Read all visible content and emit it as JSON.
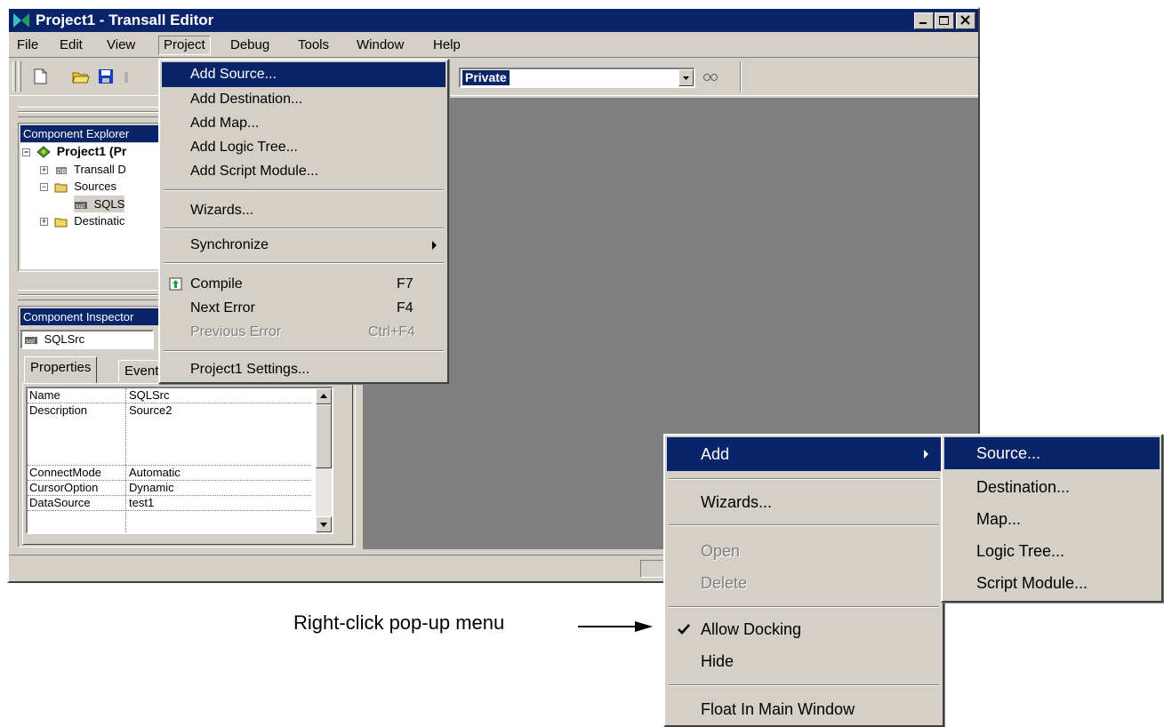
{
  "window": {
    "title": "Project1 - Transall Editor"
  },
  "menubar": [
    "File",
    "Edit",
    "View",
    "Project",
    "Debug",
    "Tools",
    "Window",
    "Help"
  ],
  "toolbar": {
    "combo_value": "Private"
  },
  "component_explorer": {
    "caption": "Component Explorer",
    "items": [
      "Project1 (Pr",
      "Transall D",
      "Sources",
      "SQLS",
      "Destinatic"
    ]
  },
  "component_inspector": {
    "caption": "Component Inspector",
    "selected_component": "SQLSrc",
    "tabs": [
      "Properties",
      "Events"
    ],
    "properties": [
      {
        "name": "Name",
        "value": "SQLSrc"
      },
      {
        "name": "Description",
        "value": "Source2"
      },
      {
        "name": "ConnectMode",
        "value": "Automatic"
      },
      {
        "name": "CursorOption",
        "value": "Dynamic"
      },
      {
        "name": "DataSource",
        "value": "test1"
      }
    ]
  },
  "project_menu": {
    "items": {
      "add_source": "Add Source...",
      "add_destination": "Add Destination...",
      "add_map": "Add Map...",
      "add_logic_tree": "Add Logic Tree...",
      "add_script_module": "Add Script Module...",
      "wizards": "Wizards...",
      "synchronize": "Synchronize",
      "compile": "Compile",
      "compile_key": "F7",
      "next_error": "Next Error",
      "next_error_key": "F4",
      "previous_error": "Previous Error",
      "previous_error_key": "Ctrl+F4",
      "settings": "Project1 Settings..."
    }
  },
  "popup_menu": {
    "add": "Add",
    "wizards": "Wizards...",
    "open": "Open",
    "delete": "Delete",
    "allow_docking": "Allow Docking",
    "hide": "Hide",
    "float": "Float In Main Window"
  },
  "add_submenu": [
    "Source...",
    "Destination...",
    "Map...",
    "Logic Tree...",
    "Script Module..."
  ],
  "annotation": "Right-click pop-up menu",
  "colors": {
    "selection": "#0a246a",
    "face": "#d4d0c8",
    "client": "#808080"
  }
}
